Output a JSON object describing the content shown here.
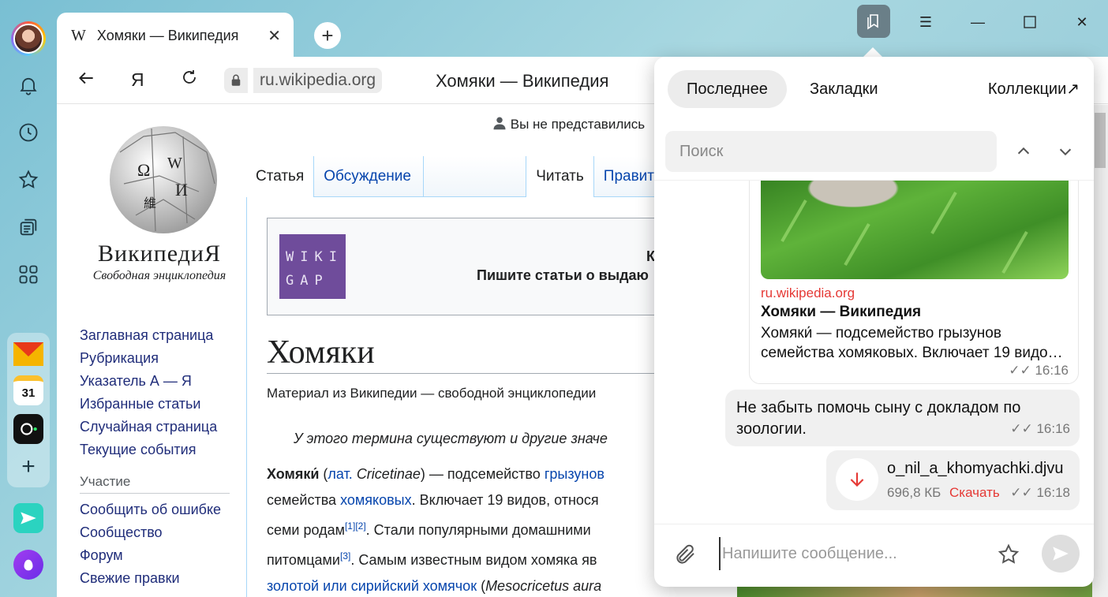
{
  "tab": {
    "icon": "W",
    "title": "Хомяки — Википедия",
    "close": "✕"
  },
  "address": {
    "yandex": "Я",
    "url": "ru.wikipedia.org",
    "title": "Хомяки — Википедия"
  },
  "wiki": {
    "logo_name": "ВикипедиЯ",
    "logo_sub": "Свободная энциклопедия",
    "user_status": "Вы не представились",
    "nav": [
      "Заглавная страница",
      "Рубрикация",
      "Указатель А — Я",
      "Избранные статьи",
      "Случайная страница",
      "Текущие события"
    ],
    "nav_section": "Участие",
    "nav2": [
      "Сообщить об ошибке",
      "Сообщество",
      "Форум",
      "Свежие правки"
    ],
    "tabs": {
      "article": "Статья",
      "talk": "Обсуждение",
      "read": "Читать",
      "edit": "Правит"
    },
    "banner": {
      "logo_l1": "WIKI",
      "logo_l2": "GAP",
      "line1": "К",
      "line2": "Пишите статьи о выдаю"
    },
    "heading": "Хомяки",
    "from": "Материал из Википедии — свободной энциклопедии",
    "note": "У этого термина существуют и другие значе",
    "para": {
      "bold": "Хомяки́",
      "lat": "лат.",
      "latin": "Cricetinae",
      "t1": "— подсемейство",
      "l1": "грызунов",
      "t2": "семейства",
      "l2": "хомяковых",
      "t3": ". Включает 19 видов, относя",
      "t4": "семи родам",
      "ref1": "[1]",
      "ref2": "[2]",
      "t5": ". Стали популярными домашними",
      "t6": "питомцами",
      "ref3": "[3]",
      "t7": ". Самым известным видом хомяка яв",
      "l3": "золотой или сирийский хомячок",
      "t8": "Mesocricetus aura"
    }
  },
  "panel": {
    "tabs": {
      "recent": "Последнее",
      "bookmarks": "Закладки",
      "collections": "Коллекции↗"
    },
    "search_placeholder": "Поиск",
    "card": {
      "source": "ru.wikipedia.org",
      "title": "Хомяки — Википедия",
      "desc": "Хомяки́ — подсемейство грызунов семейства хомяковых. Включает 19 видо…",
      "time": "✓✓ 16:16"
    },
    "message": {
      "text": "Не забыть помочь сыну с докладом по зоологии.",
      "time": "✓✓ 16:16"
    },
    "file": {
      "name": "o_nil_a_khomyachki.djvu",
      "size": "696,8 КБ",
      "action": "Скачать",
      "time": "✓✓ 16:18"
    },
    "composer_placeholder": "Напишите сообщение..."
  },
  "apps": {
    "calendar_day": "31"
  },
  "colors": {
    "accent_red": "#e53935",
    "link": "#0645ad",
    "panel_toggle": "#6a7f88"
  }
}
